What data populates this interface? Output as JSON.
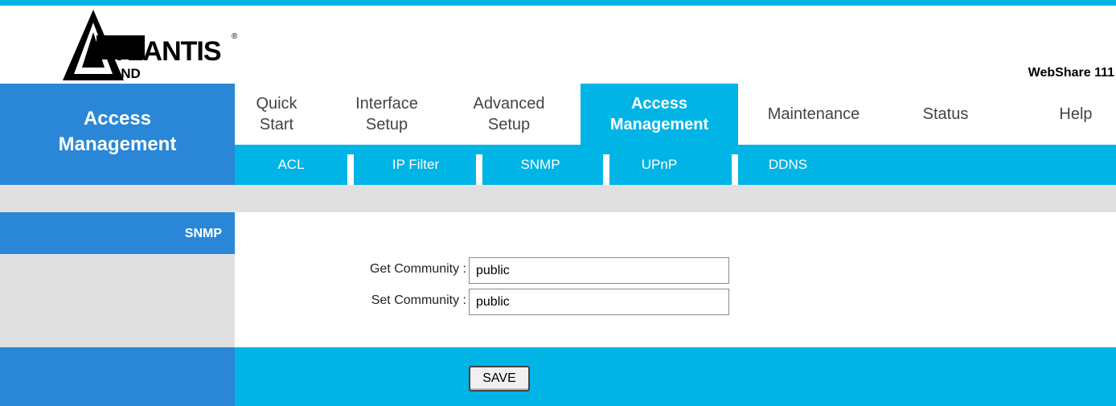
{
  "header": {
    "logo_brand": "TLANTIS",
    "logo_sub": "AND",
    "logo_reg": "®",
    "model": "WebShare 111"
  },
  "section_title": "Access\nManagement",
  "menu": {
    "items": [
      {
        "label": "Quick\nStart"
      },
      {
        "label": "Interface\nSetup"
      },
      {
        "label": "Advanced\nSetup"
      },
      {
        "label": "Access\nManagement",
        "active": true
      },
      {
        "label": "Maintenance"
      },
      {
        "label": "Status"
      },
      {
        "label": "Help"
      }
    ]
  },
  "submenu": {
    "items": [
      {
        "label": "ACL"
      },
      {
        "label": "IP Filter"
      },
      {
        "label": "SNMP"
      },
      {
        "label": "UPnP"
      },
      {
        "label": "DDNS"
      }
    ]
  },
  "content": {
    "side_label": "SNMP",
    "get_community": {
      "label": "Get Community :",
      "value": "public"
    },
    "set_community": {
      "label": "Set Community :",
      "value": "public"
    },
    "save_label": "SAVE"
  },
  "colors": {
    "accent": "#00b4e6",
    "section_blue": "#2a87d7",
    "gray_band": "#e0e0e0"
  }
}
